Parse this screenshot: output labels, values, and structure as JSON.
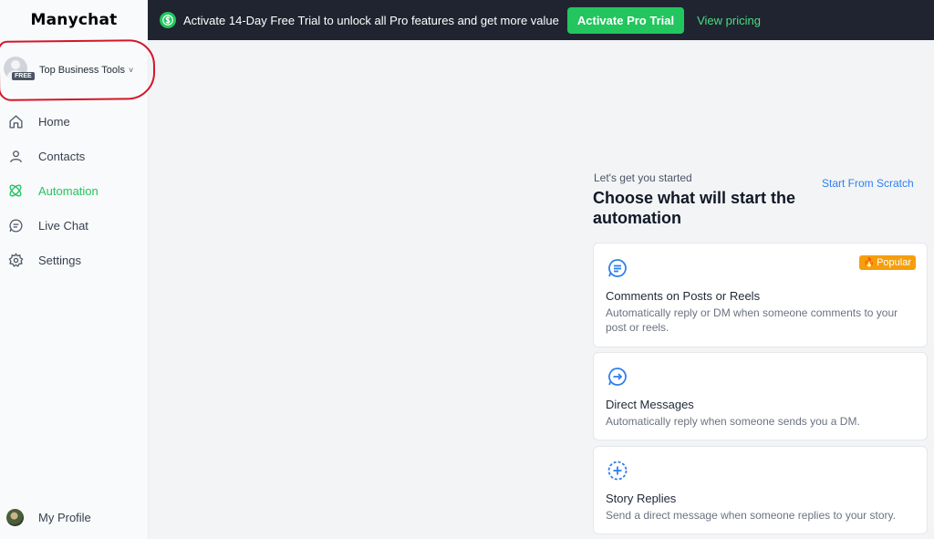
{
  "brand": {
    "logo_text": "Manychat"
  },
  "account": {
    "name": "Top Business Tools",
    "badge": "FREE",
    "chevron": "˅"
  },
  "nav": [
    {
      "label": "Home",
      "icon": "home-icon",
      "active": false
    },
    {
      "label": "Contacts",
      "icon": "user-icon",
      "active": false
    },
    {
      "label": "Automation",
      "icon": "automation-icon",
      "active": true
    },
    {
      "label": "Live Chat",
      "icon": "chat-icon",
      "active": false
    },
    {
      "label": "Settings",
      "icon": "gear-icon",
      "active": false
    }
  ],
  "profile": {
    "label": "My Profile"
  },
  "banner": {
    "text": "Activate 14-Day Free Trial to unlock all Pro features and get more value",
    "cta": "Activate Pro Trial",
    "link": "View pricing"
  },
  "main": {
    "intro": "Let's get you started",
    "title": "Choose what will start the automation",
    "scratch": "Start From Scratch",
    "triggers": [
      {
        "title": "Comments on Posts or Reels",
        "desc": "Automatically reply or DM when someone comments to your post or reels.",
        "badge": "Popular",
        "icon": "comment-icon"
      },
      {
        "title": "Direct Messages",
        "desc": "Automatically reply when someone sends you a DM.",
        "icon": "dm-icon"
      },
      {
        "title": "Story Replies",
        "desc": "Send a direct message when someone replies to your story.",
        "icon": "story-icon"
      }
    ]
  },
  "colors": {
    "accent": "#22c55e",
    "link": "#2f80ed",
    "banner_bg": "#1f2430",
    "popular": "#f59e0b",
    "annotation": "#d4162a"
  }
}
